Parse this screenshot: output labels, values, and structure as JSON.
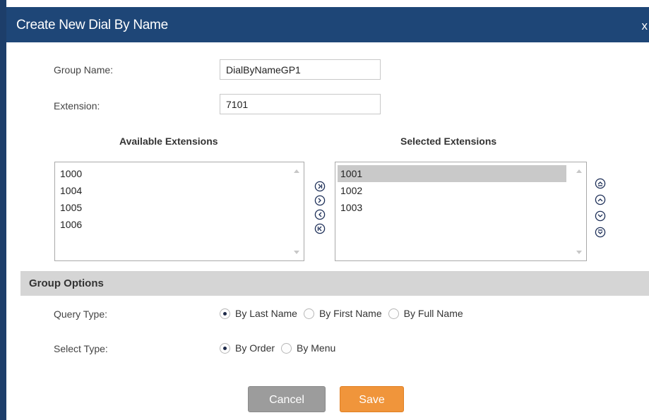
{
  "dialog": {
    "title": "Create New Dial By Name",
    "close_label": "x"
  },
  "form": {
    "group_name_label": "Group Name:",
    "group_name_value": "DialByNameGP1",
    "extension_label": "Extension:",
    "extension_value": "7101"
  },
  "available": {
    "title": "Available Extensions",
    "items": [
      "1000",
      "1004",
      "1005",
      "1006"
    ]
  },
  "selected": {
    "title": "Selected Extensions",
    "items": [
      "1001",
      "1002",
      "1003"
    ],
    "highlighted": "1001"
  },
  "transfer_icons": [
    "move-all-right-icon",
    "move-right-icon",
    "move-left-icon",
    "move-all-left-icon"
  ],
  "order_icons": [
    "move-top-icon",
    "move-up-icon",
    "move-down-icon",
    "move-bottom-icon"
  ],
  "group_options": {
    "title": "Group Options",
    "query_type": {
      "label": "Query Type:",
      "options": [
        "By Last Name",
        "By First Name",
        "By Full Name"
      ],
      "selected": "By Last Name"
    },
    "select_type": {
      "label": "Select Type:",
      "options": [
        "By Order",
        "By Menu"
      ],
      "selected": "By Order"
    }
  },
  "buttons": {
    "cancel": "Cancel",
    "save": "Save"
  },
  "colors": {
    "titlebar": "#1e4677",
    "save": "#f0953b",
    "cancel": "#9c9c9c",
    "section": "#d5d5d5"
  }
}
